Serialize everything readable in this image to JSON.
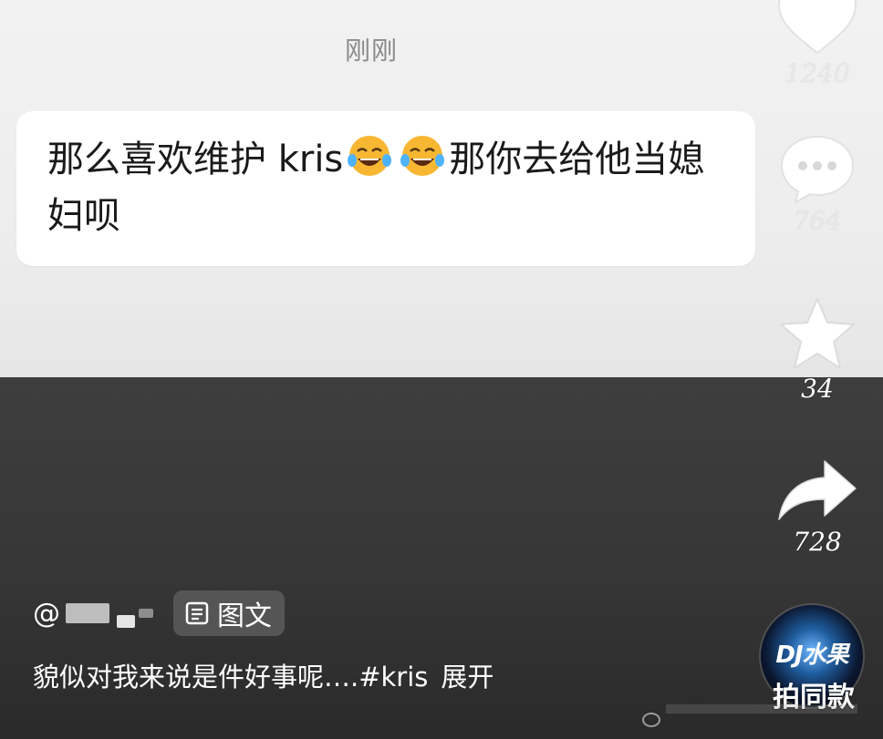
{
  "comment": {
    "timestamp": "刚刚",
    "text_before_emoji": "那么喜欢维护 kris",
    "text_after_emoji": "那你去给他当媳妇呗",
    "emoji": "laughing-with-tears-emoji"
  },
  "rail": {
    "likes": "1240",
    "comments": "764",
    "favorites": "34",
    "shares": "728"
  },
  "post": {
    "author_prefix": "@",
    "tag_label": "图文",
    "caption": "貌似对我来说是件好事呢….#kris",
    "expand_label": "展开"
  },
  "music": {
    "disc_logo": "DJ水果",
    "same_style_label": "拍同款"
  },
  "colors": {
    "top_bg": "#efefef",
    "bottom_bg": "#3a3a3a",
    "bubble_bg": "#ffffff",
    "chip_bg": "#555555"
  }
}
